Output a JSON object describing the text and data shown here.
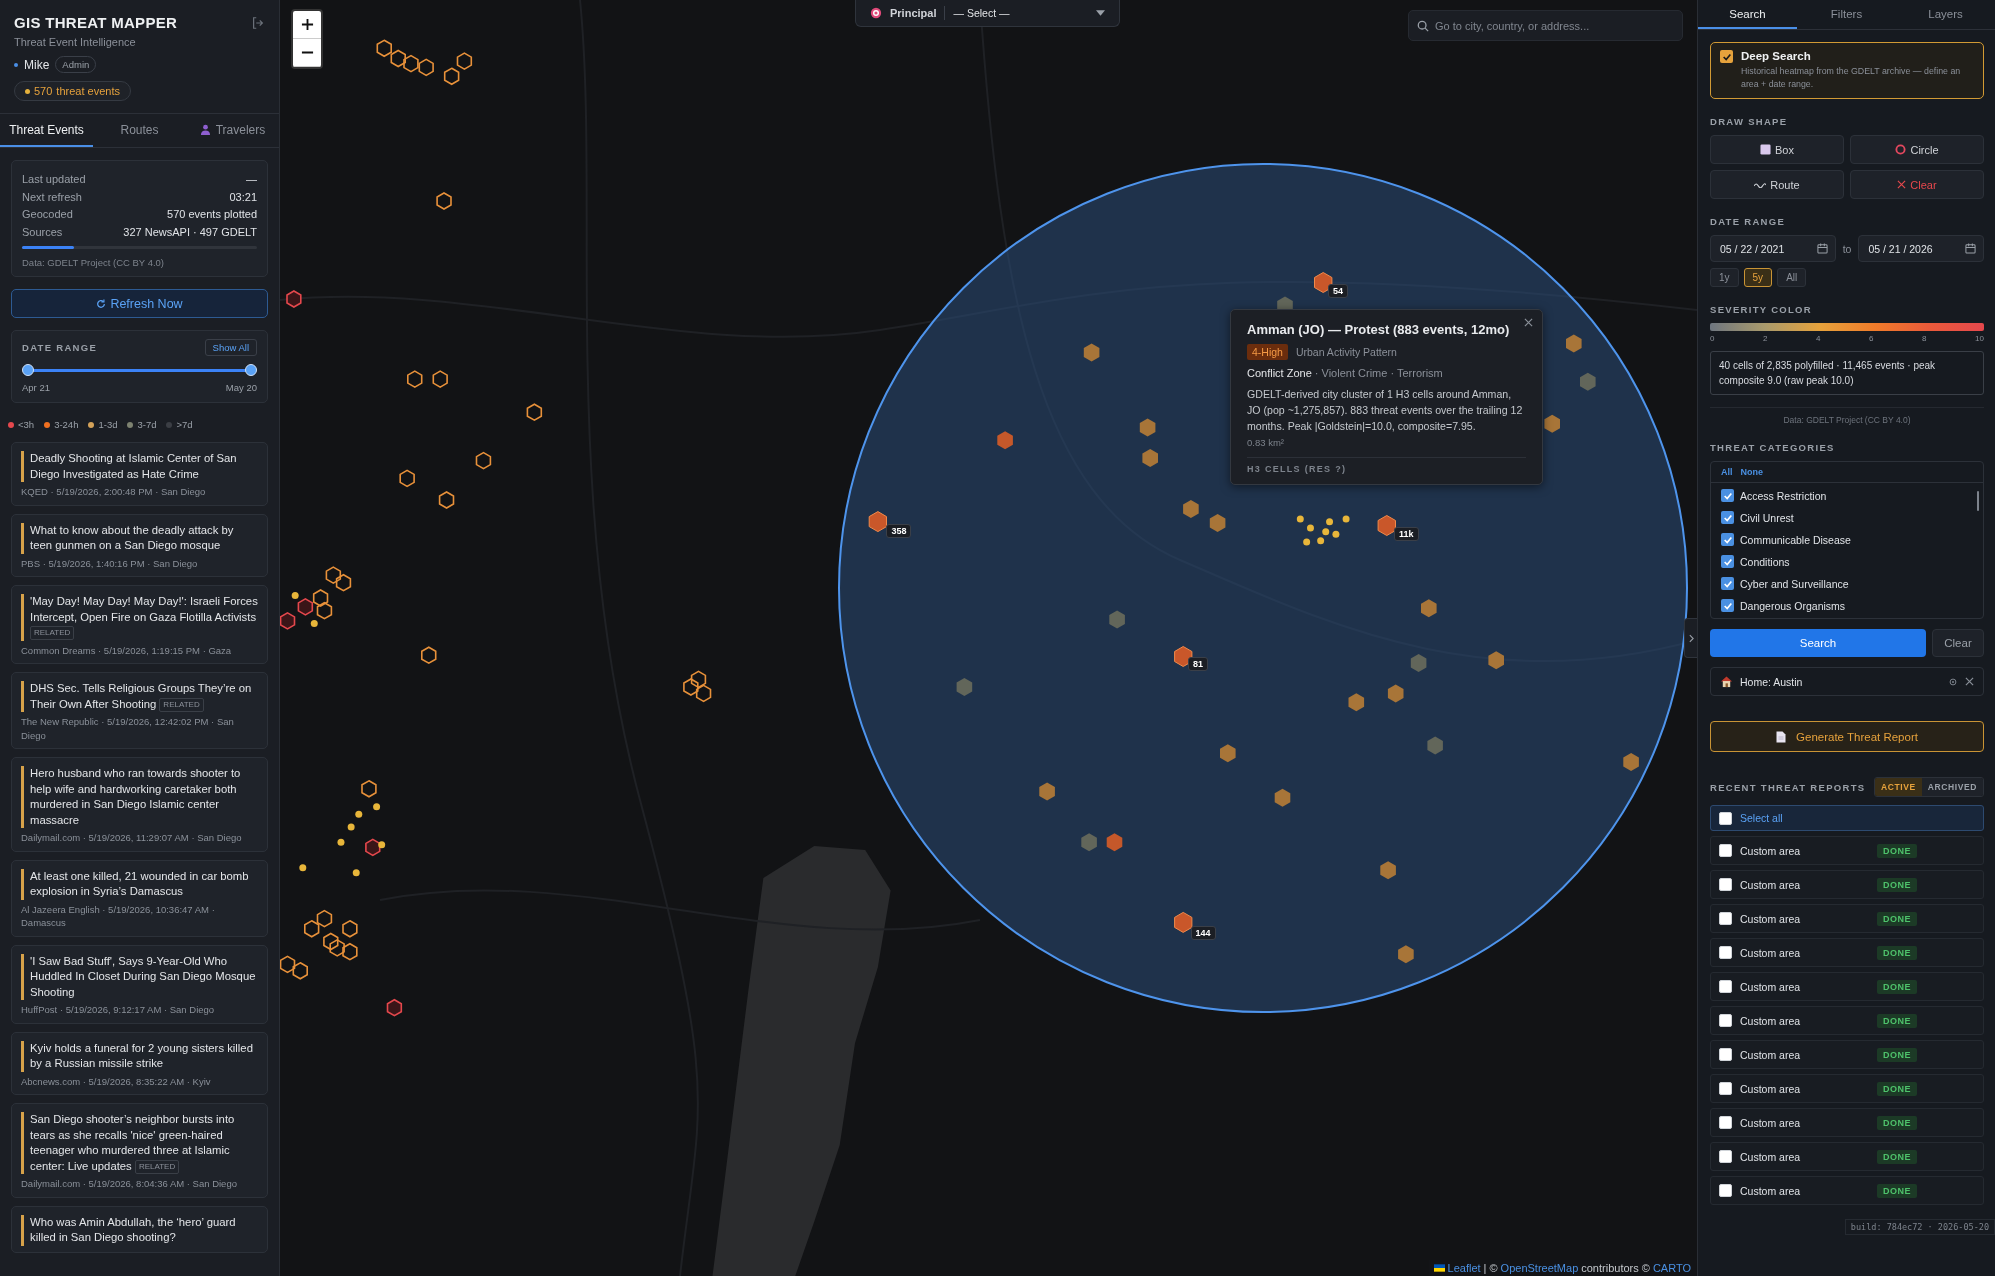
{
  "app": {
    "title": "GIS THREAT MAPPER",
    "subtitle": "Threat Event Intelligence"
  },
  "user": {
    "name": "Mike",
    "role": "Admin"
  },
  "event_count": {
    "count": "570",
    "label": "threat events"
  },
  "left_tabs": [
    {
      "label": "Threat Events",
      "selected": true,
      "kind": "plain"
    },
    {
      "label": "Routes",
      "selected": false,
      "kind": "plain"
    },
    {
      "label": "Travelers",
      "selected": false,
      "kind": "person"
    }
  ],
  "stats": {
    "rows": [
      {
        "label": "Last updated",
        "value": "—"
      },
      {
        "label": "Next refresh",
        "value": "03:21"
      },
      {
        "label": "Geocoded",
        "value": "570 events plotted"
      },
      {
        "label": "Sources",
        "value": "327 NewsAPI · 497 GDELT"
      }
    ],
    "level": 0.22,
    "note": "Data: GDELT Project (CC BY 4.0)"
  },
  "refresh_button": "Refresh Now",
  "date_range": {
    "title": "DATE RANGE",
    "show_all": "Show All",
    "thumbs": [
      {
        "level": 0
      },
      {
        "level": 1
      }
    ],
    "start_label": "Apr 21",
    "end_label": "May 20"
  },
  "legend": [
    {
      "label": "<3h",
      "color": "#e5484d"
    },
    {
      "label": "3-24h",
      "color": "#f07020"
    },
    {
      "label": "1-3d",
      "color": "#d4a259"
    },
    {
      "label": "3-7d",
      "color": "#7d8270"
    },
    {
      "label": ">7d",
      "color": "#3b3e44"
    }
  ],
  "events": [
    {
      "title": "Deadly Shooting at Islamic Center of San Diego Investigated as Hate Crime",
      "meta": "KQED · 5/19/2026, 2:00:48 PM · San Diego"
    },
    {
      "title": "What to know about the deadly attack by teen gunmen on a San Diego mosque",
      "meta": "PBS · 5/19/2026, 1:40:16 PM · San Diego"
    },
    {
      "title": "'May Day! May Day! May Day!': Israeli Forces Intercept, Open Fire on Gaza Flotilla Activists",
      "tag": "RELATED",
      "meta": "Common Dreams · 5/19/2026, 1:19:15 PM · Gaza"
    },
    {
      "title": "DHS Sec. Tells Religious Groups They’re on Their Own After Shooting",
      "tag": "RELATED",
      "meta": "The New Republic · 5/19/2026, 12:42:02 PM · San Diego"
    },
    {
      "title": "Hero husband who ran towards shooter to help wife and hardworking caretaker both murdered in San Diego Islamic center massacre",
      "meta": "Dailymail.com · 5/19/2026, 11:29:07 AM · San Diego"
    },
    {
      "title": "At least one killed, 21 wounded in car bomb explosion in Syria’s Damascus",
      "meta": "Al Jazeera English · 5/19/2026, 10:36:47 AM · Damascus"
    },
    {
      "title": "'I Saw Bad Stuff', Says 9-Year-Old Who Huddled In Closet During San Diego Mosque Shooting",
      "meta": "HuffPost · 5/19/2026, 9:12:17 AM · San Diego"
    },
    {
      "title": "Kyiv holds a funeral for 2 young sisters killed by a Russian missile strike",
      "meta": "Abcnews.com · 5/19/2026, 8:35:22 AM · Kyiv"
    },
    {
      "title": "San Diego shooter’s neighbor bursts into tears as she recalls 'nice' green-haired teenager who murdered three at Islamic center: Live updates",
      "tag": "RELATED",
      "meta": "Dailymail.com · 5/19/2026, 8:04:36 AM · San Diego"
    },
    {
      "title": "Who was Amin Abdullah, the ‘hero’ guard killed in San Diego shooting?"
    }
  ],
  "map": {
    "principal": {
      "label": "Principal",
      "value": "— Select —"
    },
    "search": {
      "placeholder": "Go to city, country, or address..."
    },
    "clusters": [
      {
        "count": "54"
      },
      {
        "count": "358"
      },
      {
        "count": "11k"
      },
      {
        "count": "81"
      },
      {
        "count": "144"
      }
    ],
    "popup": {
      "title": "Amman (JO) — Protest (883 events, 12mo)",
      "severity": "4-High",
      "pattern": "Urban Activity Pattern",
      "primary_category": "Conflict Zone",
      "other_categories": "· Violent Crime · Terrorism",
      "description": "GDELT-derived city cluster of 1 H3 cells around Amman, JO (pop ~1,275,857). 883 threat events over the trailing 12 months. Peak |Goldstein|=10.0, composite=7.95.",
      "area": "0.83 km²",
      "cells_title": "H3 CELLS (RES ?)"
    },
    "attribution": [
      {
        "text": "Leaflet",
        "link": true
      },
      {
        "text": "| ©",
        "link": false
      },
      {
        "text": "OpenStreetMap",
        "link": true
      },
      {
        "text": "contributors ©",
        "link": false
      },
      {
        "text": "CARTO",
        "link": true
      }
    ]
  },
  "right_tabs": [
    {
      "label": "Search",
      "selected": true
    },
    {
      "label": "Filters",
      "selected": false
    },
    {
      "label": "Layers",
      "selected": false
    }
  ],
  "deep_search": {
    "checked": true,
    "title": "Deep Search",
    "description": "Historical heatmap from the GDELT archive — define an area + date range."
  },
  "draw_shape": {
    "title": "DRAW SHAPE",
    "buttons": [
      {
        "label": "Box",
        "kind": "box"
      },
      {
        "label": "Circle",
        "kind": "circle"
      },
      {
        "label": "Route",
        "kind": "route"
      },
      {
        "label": "Clear",
        "kind": "clear"
      }
    ]
  },
  "search_dates": {
    "title": "DATE RANGE",
    "from": "05 / 22 / 2021",
    "separator": "to",
    "to": "05 / 21 / 2026",
    "presets": [
      {
        "label": "1y",
        "selected": false
      },
      {
        "label": "5y",
        "selected": true
      },
      {
        "label": "All",
        "selected": false
      }
    ]
  },
  "severity": {
    "title": "SEVERITY COLOR",
    "ticks": [
      "0",
      "2",
      "4",
      "6",
      "8",
      "10"
    ]
  },
  "summary": "40 cells of 2,835 polyfilled · 11,465 events · peak composite 9.0 (raw peak 10.0)",
  "data_note": "Data: GDELT Project (CC BY 4.0)",
  "categories": {
    "title": "THREAT CATEGORIES",
    "all": "All",
    "none": "None",
    "items": [
      {
        "label": "Access Restriction",
        "checked": true
      },
      {
        "label": "Civil Unrest",
        "checked": true
      },
      {
        "label": "Communicable Disease",
        "checked": true
      },
      {
        "label": "Conditions",
        "checked": true
      },
      {
        "label": "Cyber and Surveillance",
        "checked": true
      },
      {
        "label": "Dangerous Organisms",
        "checked": true
      }
    ]
  },
  "search_button": "Search",
  "clear_button": "Clear",
  "home": {
    "label": "Home: Austin"
  },
  "report_button": "Generate Threat Report",
  "reports": {
    "title": "RECENT THREAT REPORTS",
    "filters": [
      {
        "label": "ACTIVE",
        "selected": true
      },
      {
        "label": "ARCHIVED",
        "selected": false
      }
    ],
    "select_all": {
      "label": "Select all",
      "checked": false
    },
    "items": [
      {
        "name": "Custom area",
        "status": "DONE",
        "checked": false
      },
      {
        "name": "Custom area",
        "status": "DONE",
        "checked": false
      },
      {
        "name": "Custom area",
        "status": "DONE",
        "checked": false
      },
      {
        "name": "Custom area",
        "status": "DONE",
        "checked": false
      },
      {
        "name": "Custom area",
        "status": "DONE",
        "checked": false
      },
      {
        "name": "Custom area",
        "status": "DONE",
        "checked": false
      },
      {
        "name": "Custom area",
        "status": "DONE",
        "checked": false
      },
      {
        "name": "Custom area",
        "status": "DONE",
        "checked": false
      },
      {
        "name": "Custom area",
        "status": "DONE",
        "checked": false
      },
      {
        "name": "Custom area",
        "status": "DONE",
        "checked": false
      },
      {
        "name": "Custom area",
        "status": "DONE",
        "checked": false
      }
    ]
  },
  "build": "build: 784ec72 · 2026-05-20"
}
